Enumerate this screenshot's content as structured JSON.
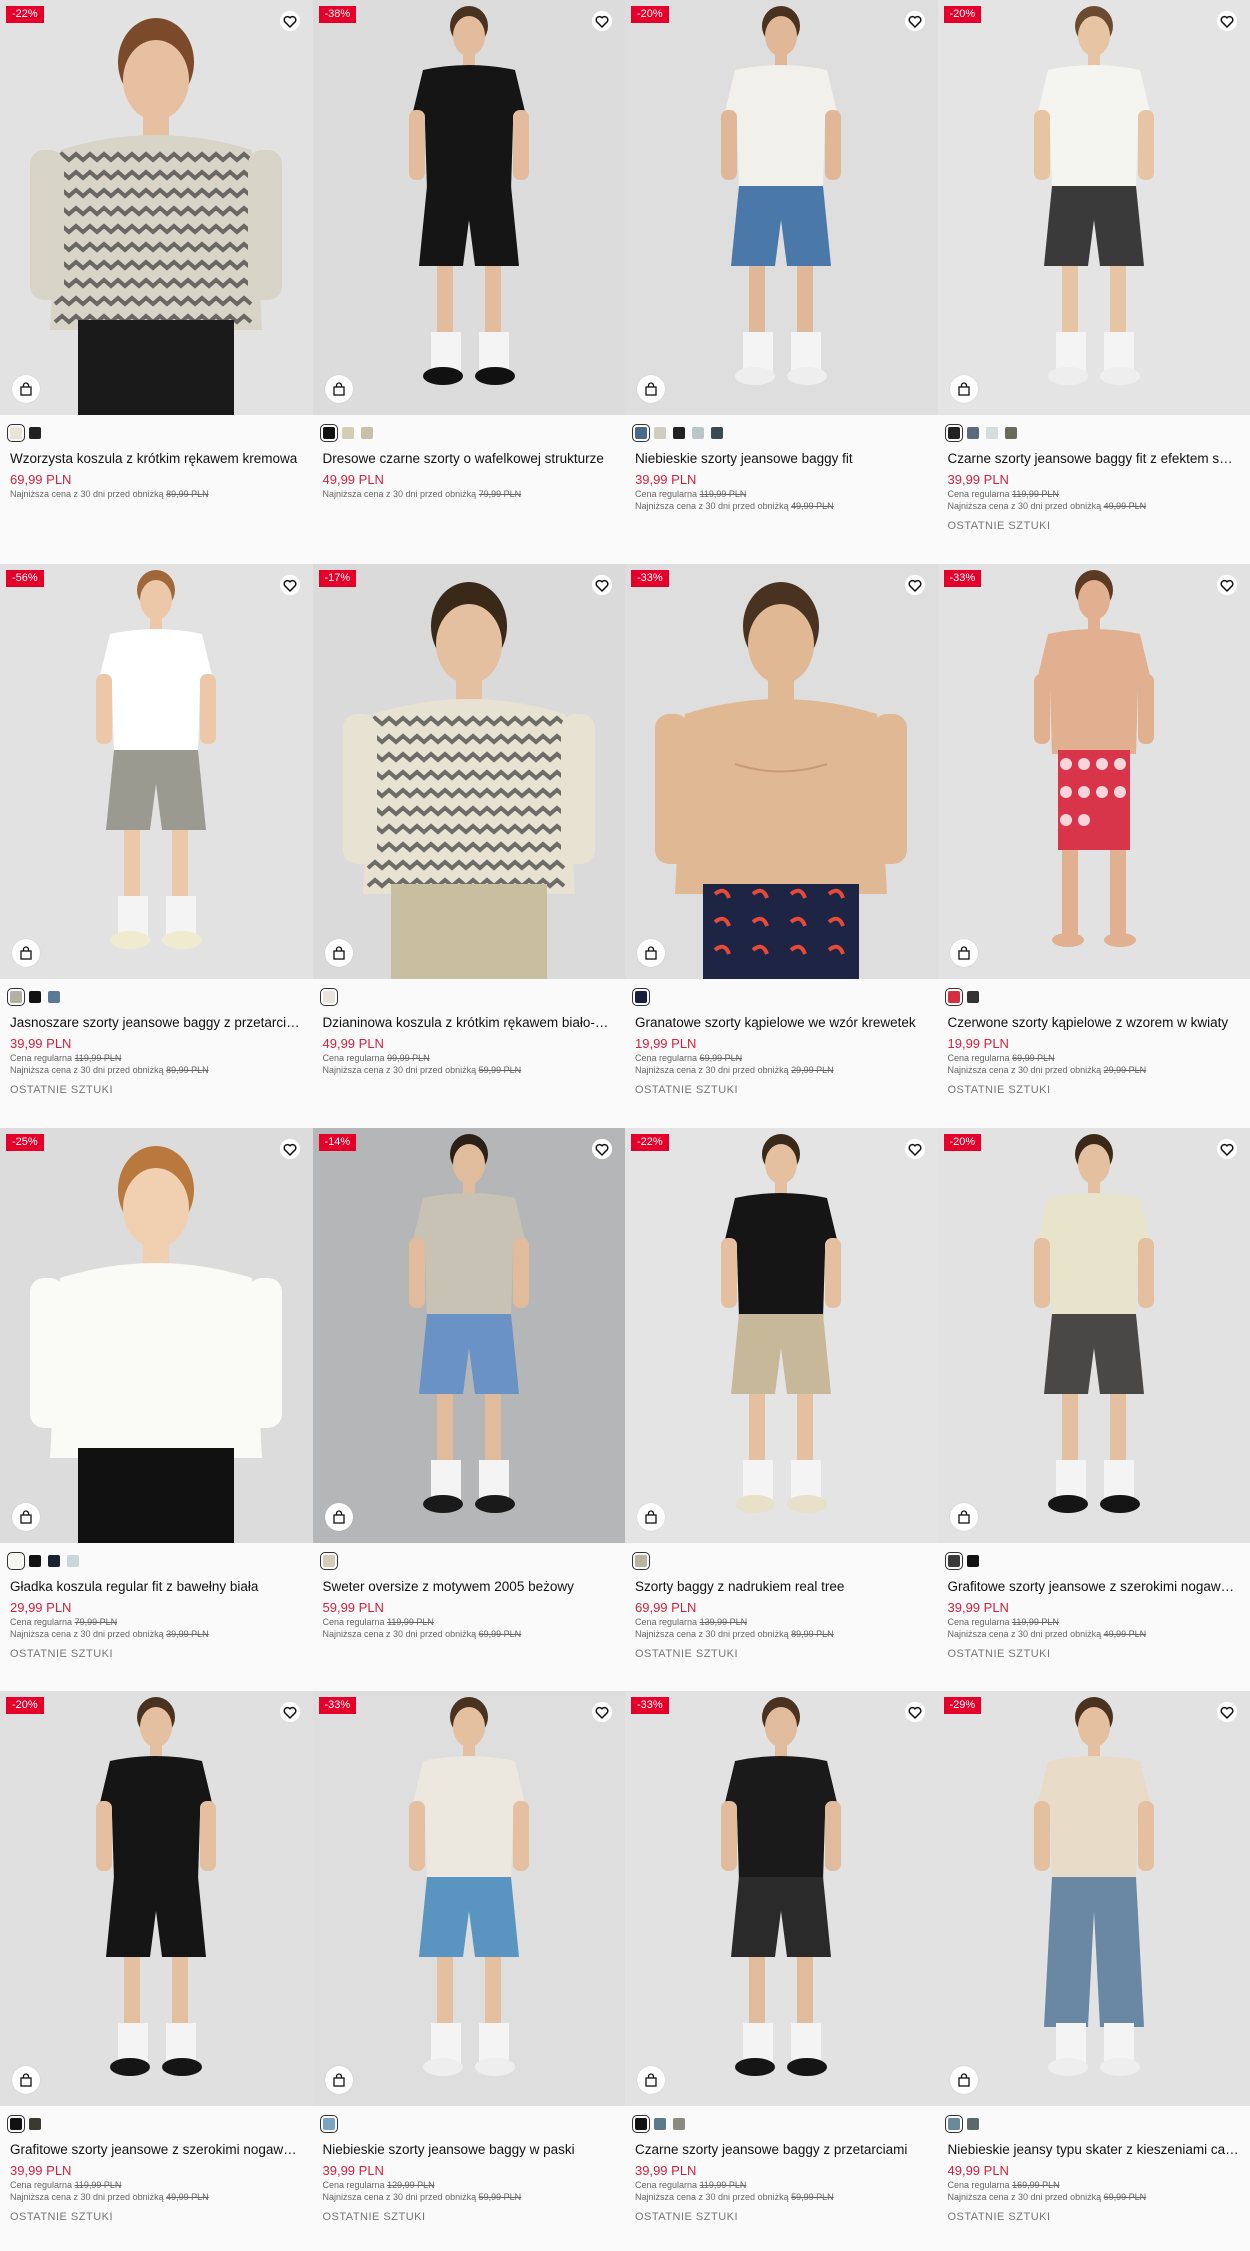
{
  "labels": {
    "regular": "Cena regularna",
    "lowest": "Najniższa cena z 30 dni przed obniżką",
    "last": "OSTATNIE SZTUKI"
  },
  "products": [
    {
      "name": "Wzorzysta koszula z krótkim rękawem kremowa",
      "price": "69,99 PLN",
      "discount": "-22%",
      "regular": "",
      "lowest": "89,99 PLN",
      "last": false,
      "swatches": [
        "#e8e4d8",
        "#222222"
      ],
      "bg": "#e2e2e2",
      "top": "#d8d4c8",
      "topPattern": "zigzag",
      "bottom": "#1a1a1a",
      "skin": "#e6c0a0",
      "hair": "#7a4a2a",
      "closeup": true
    },
    {
      "name": "Dresowe czarne szorty o wafelkowej strukturze",
      "price": "49,99 PLN",
      "discount": "-38%",
      "regular": "",
      "lowest": "79,99 PLN",
      "last": false,
      "swatches": [
        "#111111",
        "#d4ccb4",
        "#c8c0a8"
      ],
      "bg": "#dcdcdc",
      "top": "#151515",
      "bottom": "#151515",
      "skin": "#e2bc9c",
      "hair": "#4a3220",
      "shoes": "#111111"
    },
    {
      "name": "Niebieskie szorty jeansowe baggy fit",
      "price": "39,99 PLN",
      "discount": "-20%",
      "regular": "119,99 PLN",
      "lowest": "49,99 PLN",
      "last": false,
      "swatches": [
        "#4a6a8a",
        "#d0ccc0",
        "#222222",
        "#b8c8c8",
        "#3a4a50"
      ],
      "bg": "#dedede",
      "top": "#f2f0ea",
      "bottom": "#4a78a8",
      "skin": "#e0b898",
      "hair": "#4a3220",
      "shoes": "#eeeeee"
    },
    {
      "name": "Czarne szorty jeansowe baggy fit z efektem sprania",
      "price": "39,99 PLN",
      "discount": "-20%",
      "regular": "119,99 PLN",
      "lowest": "49,99 PLN",
      "last": true,
      "swatches": [
        "#222222",
        "#5a6a7a",
        "#d4dcdc",
        "#6a6a5a"
      ],
      "bg": "#e4e4e4",
      "top": "#f4f4f0",
      "bottom": "#3a3a3a",
      "skin": "#e6c4a4",
      "hair": "#6a4a30",
      "shoes": "#eeeeee"
    },
    {
      "name": "Jasnoszare szorty jeansowe baggy z przetarciami",
      "price": "39,99 PLN",
      "discount": "-56%",
      "regular": "119,99 PLN",
      "lowest": "89,99 PLN",
      "last": true,
      "swatches": [
        "#b4b0a4",
        "#111111",
        "#5a7a9a"
      ],
      "bg": "#e2e2e2",
      "top": "#ffffff",
      "bottom": "#9a9a90",
      "skin": "#ecc8a8",
      "hair": "#a0683a",
      "shoes": "#f0ead0"
    },
    {
      "name": "Dzianinowa koszula z krótkim rękawem biało-czarna",
      "price": "49,99 PLN",
      "discount": "-17%",
      "regular": "99,99 PLN",
      "lowest": "59,99 PLN",
      "last": false,
      "swatches": [
        "#e8e4dc"
      ],
      "bg": "#dadada",
      "top": "#e8e2d2",
      "topPattern": "zigzag",
      "bottom": "#c8bea0",
      "skin": "#e4c0a0",
      "hair": "#3a2818",
      "closeup": true
    },
    {
      "name": "Granatowe szorty kąpielowe we wzór krewetek",
      "price": "19,99 PLN",
      "discount": "-33%",
      "regular": "69,99 PLN",
      "lowest": "29,99 PLN",
      "last": true,
      "swatches": [
        "#1a1f3a"
      ],
      "bg": "#dedede",
      "top": "skin",
      "bottom": "#1e2444",
      "skin": "#e0b894",
      "hair": "#4a3220",
      "closeup": true
    },
    {
      "name": "Czerwone szorty kąpielowe z wzorem w kwiaty",
      "price": "19,99 PLN",
      "discount": "-33%",
      "regular": "69,99 PLN",
      "lowest": "29,99 PLN",
      "last": true,
      "swatches": [
        "#d43040",
        "#333333"
      ],
      "bg": "#e2e2e2",
      "top": "skin",
      "bottom": "#d8344a",
      "skin": "#e0b090",
      "hair": "#5a3a22",
      "shoes": "skin"
    },
    {
      "name": "Gładka koszula regular fit z bawełny biała",
      "price": "29,99 PLN",
      "discount": "-25%",
      "regular": "79,99 PLN",
      "lowest": "39,99 PLN",
      "last": true,
      "swatches": [
        "#f4f4f0",
        "#111111",
        "#1a2030",
        "#c8d8d8"
      ],
      "bg": "#dcdcdc",
      "top": "#fafaf6",
      "bottom": "#111111",
      "skin": "#f0d0b0",
      "hair": "#b8783e",
      "closeup": true
    },
    {
      "name": "Sweter oversize z motywem 2005 beżowy",
      "price": "59,99 PLN",
      "discount": "-14%",
      "regular": "119,99 PLN",
      "lowest": "69,99 PLN",
      "last": false,
      "swatches": [
        "#d4ccb8"
      ],
      "bg": "#b4b6b8",
      "top": "#c8c2b4",
      "bottom": "#6a92c4",
      "skin": "#e0bc9c",
      "hair": "#2a2018",
      "shoes": "#1a1a1a"
    },
    {
      "name": "Szorty baggy z nadrukiem real tree",
      "price": "69,99 PLN",
      "discount": "-22%",
      "regular": "139,99 PLN",
      "lowest": "89,99 PLN",
      "last": true,
      "swatches": [
        "#b8b4a0"
      ],
      "bg": "#e4e4e4",
      "top": "#151515",
      "bottom": "#c8b89a",
      "skin": "#e4c0a0",
      "hair": "#3a2818",
      "shoes": "#e8e0c8"
    },
    {
      "name": "Grafitowe szorty jeansowe z szerokimi nogawkami",
      "price": "39,99 PLN",
      "discount": "-20%",
      "regular": "119,99 PLN",
      "lowest": "49,99 PLN",
      "last": true,
      "swatches": [
        "#3a3a3a",
        "#111111"
      ],
      "bg": "#e2e2e2",
      "top": "#e8e4cc",
      "bottom": "#4a4846",
      "skin": "#e4c0a0",
      "hair": "#3a2818",
      "shoes": "#151515"
    },
    {
      "name": "Grafitowe szorty jeansowe z szerokimi nogawkami",
      "price": "39,99 PLN",
      "discount": "-20%",
      "regular": "119,99 PLN",
      "lowest": "49,99 PLN",
      "last": true,
      "swatches": [
        "#111111",
        "#3a3a30"
      ],
      "bg": "#e0e0e0",
      "top": "#151515",
      "bottom": "#151515",
      "skin": "#e4c0a0",
      "hair": "#4a3220",
      "shoes": "#151515"
    },
    {
      "name": "Niebieskie szorty jeansowe baggy w paski",
      "price": "39,99 PLN",
      "discount": "-33%",
      "regular": "129,99 PLN",
      "lowest": "59,99 PLN",
      "last": true,
      "swatches": [
        "#7aa4c4"
      ],
      "bg": "#dedede",
      "top": "#ece8e0",
      "bottom": "#5a94c0",
      "skin": "#e4c0a0",
      "hair": "#4a3220",
      "shoes": "#eeeeee"
    },
    {
      "name": "Czarne szorty jeansowe baggy z przetarciami",
      "price": "39,99 PLN",
      "discount": "-33%",
      "regular": "119,99 PLN",
      "lowest": "59,99 PLN",
      "last": true,
      "swatches": [
        "#111111",
        "#5a7a8a",
        "#8a8a80"
      ],
      "bg": "#e2e2e2",
      "top": "#1a1a1a",
      "bottom": "#2a2a2a",
      "skin": "#e0bc9c",
      "hair": "#4a3220",
      "shoes": "#151515"
    },
    {
      "name": "Niebieskie jeansy typu skater z kieszeniami cargo",
      "price": "49,99 PLN",
      "discount": "-29%",
      "regular": "169,99 PLN",
      "lowest": "69,99 PLN",
      "last": true,
      "swatches": [
        "#6a8a9a",
        "#5a6a6a"
      ],
      "bg": "#e2e2e2",
      "top": "#e8dcc8",
      "bottom": "#6a88a4",
      "skin": "#e4c0a0",
      "hair": "#4a3220",
      "shoes": "#eeeeee",
      "long": true
    }
  ]
}
